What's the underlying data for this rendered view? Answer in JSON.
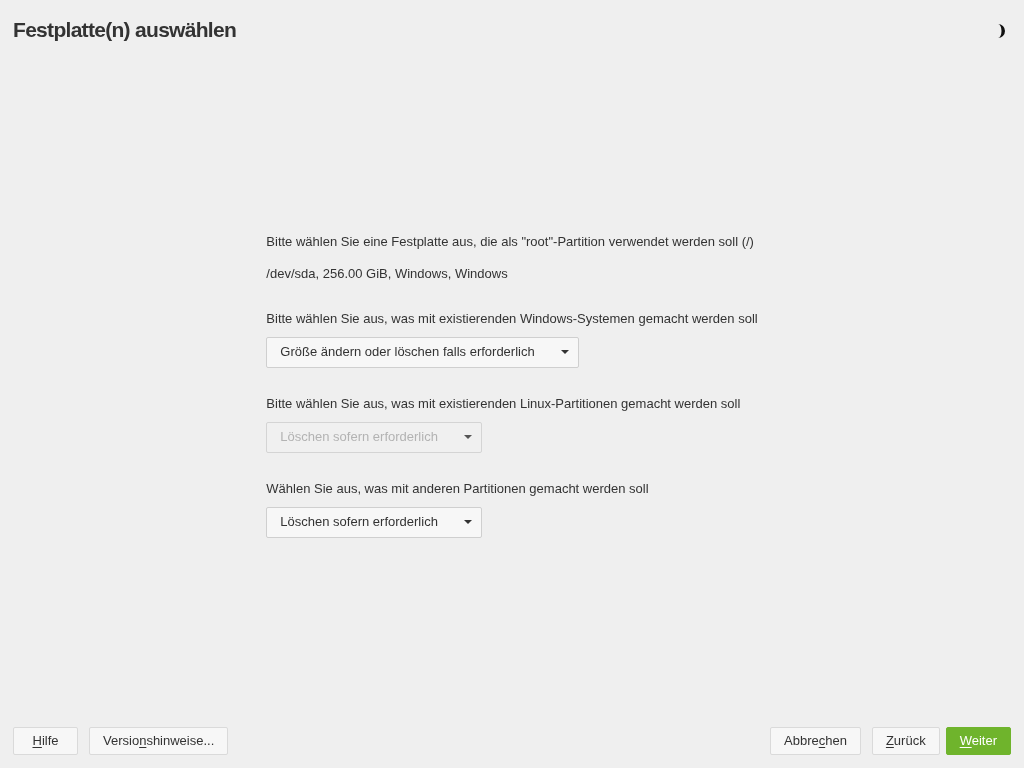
{
  "window": {
    "title": "Festplatte(n) auswählen"
  },
  "intro": "Bitte wählen Sie eine Festplatte aus, die als \"root\"-Partition verwendet werden soll (/)",
  "disk": "/dev/sda, 256.00 GiB, Windows, Windows",
  "options": [
    {
      "label": "Bitte wählen Sie aus, was mit existierenden Windows-Systemen gemacht werden soll",
      "value": "Größe ändern oder löschen falls erforderlich",
      "disabled": false
    },
    {
      "label": "Bitte wählen Sie aus, was mit existierenden Linux-Partitionen gemacht werden soll",
      "value": "Löschen sofern erforderlich",
      "disabled": true
    },
    {
      "label": "Wählen Sie aus, was mit anderen Partitionen gemacht werden soll",
      "value": "Löschen sofern erforderlich",
      "disabled": false
    }
  ],
  "footer": {
    "left": [
      {
        "mnemonic": "H",
        "after": "ilfe"
      },
      {
        "before": "Versio",
        "mnemonic": "n",
        "after": "shinweise..."
      }
    ],
    "right": [
      {
        "before": "Abbre",
        "mnemonic": "c",
        "after": "hen",
        "kind": "default"
      },
      {
        "mnemonic": "Z",
        "after": "urück",
        "kind": "default"
      },
      {
        "mnemonic": "W",
        "after": "eiter",
        "kind": "primary"
      }
    ]
  }
}
